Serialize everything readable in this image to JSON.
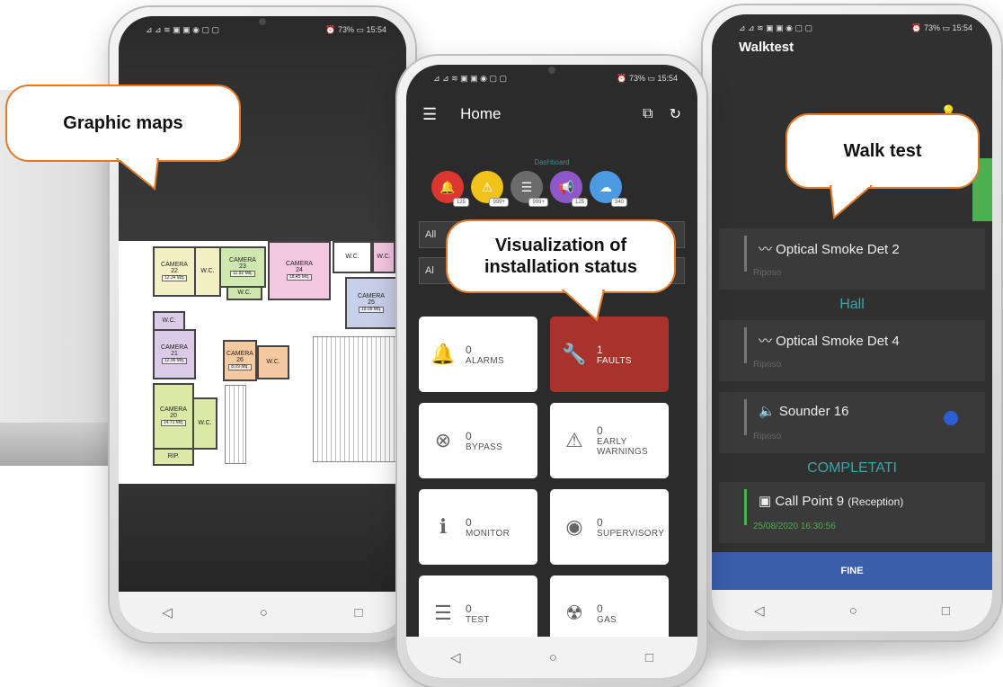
{
  "callouts": {
    "left": "Graphic maps",
    "center": "Visualization of installation status",
    "right": "Walk test"
  },
  "status": {
    "signal_icons": "⊿ ⊿ ≋ ▣ ▣ ◉ ▢ ▢",
    "battery": "73%",
    "time": "15:54"
  },
  "left_map": {
    "rooms": [
      {
        "id": "camera22",
        "name": "CAMERA",
        "num": "22",
        "area": "12.34 Mq."
      },
      {
        "id": "wc1",
        "name": "W.C."
      },
      {
        "id": "camera23",
        "name": "CAMERA",
        "num": "23",
        "area": "11.92 Mq."
      },
      {
        "id": "wc2",
        "name": "W.C."
      },
      {
        "id": "camera24",
        "name": "CAMERA",
        "num": "24",
        "area": "18.45 Mq."
      },
      {
        "id": "wc3",
        "name": "W.C."
      },
      {
        "id": "wc4",
        "name": "W.C."
      },
      {
        "id": "camera25",
        "name": "CAMERA",
        "num": "25",
        "area": "19.09 Mq."
      },
      {
        "id": "wc5",
        "name": "W.C."
      },
      {
        "id": "camera21",
        "name": "CAMERA",
        "num": "21",
        "area": "12.96 Mq."
      },
      {
        "id": "camera26",
        "name": "CAMERA",
        "num": "26",
        "area": "8.09 Mq."
      },
      {
        "id": "wc6",
        "name": "W.C."
      },
      {
        "id": "camera20",
        "name": "CAMERA",
        "num": "20",
        "area": "14.71 Mq."
      },
      {
        "id": "wc7",
        "name": "W.C."
      },
      {
        "id": "rip",
        "name": "RIP."
      }
    ]
  },
  "center_app": {
    "title": "Home",
    "dashboard_label": "Dashboard",
    "dashboard_items": [
      {
        "icon": "bell-icon",
        "count": "125",
        "color": "#d9372f",
        "glyph": "🔔"
      },
      {
        "icon": "warning-icon",
        "count": "999+",
        "color": "#f0c21a",
        "glyph": "⚠"
      },
      {
        "icon": "list-icon",
        "count": "999+",
        "color": "#6b6b6b",
        "glyph": "☰"
      },
      {
        "icon": "megaphone-icon",
        "count": "125",
        "color": "#8e58c9",
        "glyph": "📢"
      },
      {
        "icon": "cloud-icon",
        "count": "340",
        "color": "#4c9ae2",
        "glyph": "☁"
      }
    ],
    "filter_1": "All",
    "filter_2": "Al",
    "tiles": [
      {
        "key": "alarms",
        "value": "0",
        "label": "ALARMS",
        "icon": "bell-icon",
        "glyph": "🔔"
      },
      {
        "key": "faults",
        "value": "1",
        "label": "FAULTS",
        "icon": "wrench-icon",
        "glyph": "🔧"
      },
      {
        "key": "bypass",
        "value": "0",
        "label": "BYPASS",
        "icon": "bypass-icon",
        "glyph": "⊗"
      },
      {
        "key": "early",
        "value": "0",
        "label": "EARLY\nWARNINGS",
        "icon": "warning-icon",
        "glyph": "⚠"
      },
      {
        "key": "monitor",
        "value": "0",
        "label": "MONITOR",
        "icon": "info-icon",
        "glyph": "ℹ"
      },
      {
        "key": "supervisory",
        "value": "0",
        "label": "SUPERVISORY",
        "icon": "eye-icon",
        "glyph": "◉"
      },
      {
        "key": "test",
        "value": "0",
        "label": "TEST",
        "icon": "checklist-icon",
        "glyph": "☰"
      },
      {
        "key": "gas",
        "value": "0",
        "label": "GAS",
        "icon": "gas-mask-icon",
        "glyph": "☢"
      }
    ]
  },
  "right_app": {
    "title": "Walktest",
    "hint_icon": "bulb-icon",
    "devices": [
      {
        "name": "Optical Smoke Det 2",
        "state": "Riposo"
      },
      {
        "name": "Optical Smoke Det 4",
        "state": "Riposo"
      },
      {
        "name": "Sounder 16",
        "state": "Riposo"
      },
      {
        "name": "Call Point 9",
        "location": "(Reception)",
        "state": "25/08/2020 16:30:56"
      }
    ],
    "section_hall": "Hall",
    "section_done": "COMPLETATI",
    "fine_button": "FINE"
  },
  "colors": {
    "accent_orange": "#e07a2a",
    "fault_red": "#a8322c",
    "teal": "#3aa6a6",
    "button_blue": "#3b5eab"
  }
}
